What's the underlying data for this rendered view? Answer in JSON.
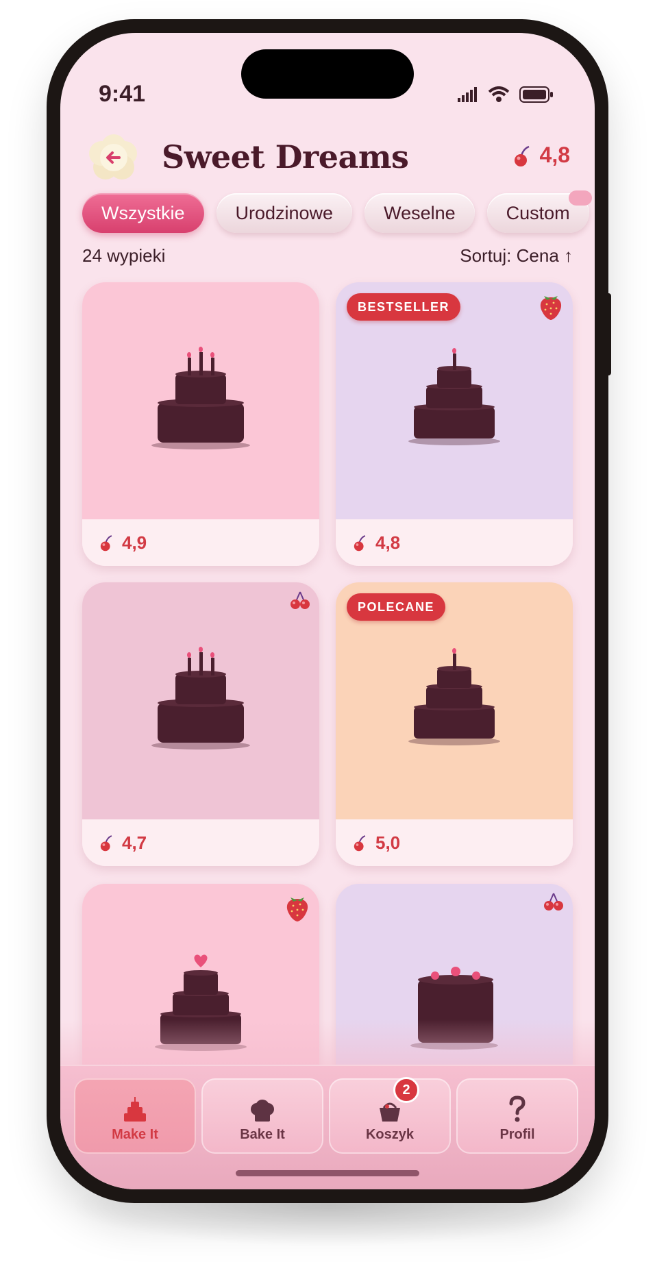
{
  "status_bar": {
    "time": "9:41"
  },
  "header": {
    "title": "Sweet Dreams",
    "rating": "4,8",
    "back_icon": "back-arrow-icon",
    "rating_icon": "cherry-icon"
  },
  "tabs": [
    {
      "label": "Wszystkie",
      "active": true
    },
    {
      "label": "Urodzinowe",
      "active": false
    },
    {
      "label": "Weselne",
      "active": false
    },
    {
      "label": "Custom",
      "active": false
    }
  ],
  "list_info": {
    "count": "24 wypieki",
    "sort": "Sortuj: Cena ↑"
  },
  "products": [
    {
      "rating": "4,9",
      "badge": "",
      "bg": "#fbc6d6",
      "deco": ""
    },
    {
      "rating": "4,8",
      "badge": "BESTSELLER",
      "bg": "#e6d5ef",
      "deco": "strawberry-icon"
    },
    {
      "rating": "4,7",
      "badge": "",
      "bg": "#efc4d5",
      "deco": "cherries-icon"
    },
    {
      "rating": "5,0",
      "badge": "POLECANE",
      "bg": "#fbd3b8",
      "deco": ""
    },
    {
      "rating": "",
      "badge": "",
      "bg": "#fbc6d6",
      "deco": "strawberry-icon"
    },
    {
      "rating": "",
      "badge": "",
      "bg": "#e6d5ef",
      "deco": "cherries-icon"
    }
  ],
  "bottom_nav": [
    {
      "label": "Make It",
      "icon": "cake-icon",
      "active": true,
      "badge": ""
    },
    {
      "label": "Bake It",
      "icon": "chef-hat-icon",
      "active": false,
      "badge": ""
    },
    {
      "label": "Koszyk",
      "icon": "basket-icon",
      "active": false,
      "badge": "2"
    },
    {
      "label": "Profil",
      "icon": "question-icon",
      "active": false,
      "badge": ""
    }
  ],
  "colors": {
    "accent": "#d23a44",
    "primary_pink": "#e0507a",
    "text_dark": "#4a1a2a",
    "screen_bg": "#fae3ec",
    "cake": "#4a1f2e"
  }
}
